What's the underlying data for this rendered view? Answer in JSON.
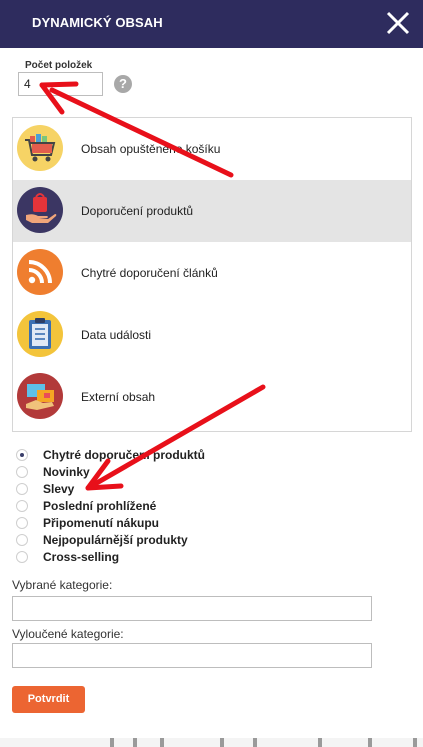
{
  "header": {
    "title": "DYNAMICKÝ OBSAH",
    "close_icon": "close-icon"
  },
  "count": {
    "label": "Počet položek",
    "value": "4",
    "help_icon": "help-icon",
    "help_glyph": "?"
  },
  "content_types": [
    {
      "label": "Obsah opuštěného košíku",
      "icon": "shopping-cart-icon",
      "selected": false
    },
    {
      "label": "Doporučení produktů",
      "icon": "product-recommendation-icon",
      "selected": true
    },
    {
      "label": "Chytré doporučení článků",
      "icon": "rss-icon",
      "selected": false
    },
    {
      "label": "Data události",
      "icon": "clipboard-icon",
      "selected": false
    },
    {
      "label": "Externí obsah",
      "icon": "external-content-icon",
      "selected": false
    }
  ],
  "recommendation_types": {
    "selected": "Chytré doporučení produktů",
    "options": [
      "Chytré doporučení produktů",
      "Novinky",
      "Slevy",
      "Poslední prohlížené",
      "Připomenutí nákupu",
      "Nejpopulárnější produkty",
      "Cross-selling"
    ]
  },
  "included_categories": {
    "label": "Vybrané kategorie:",
    "value": ""
  },
  "excluded_categories": {
    "label": "Vyloučené kategorie:",
    "value": ""
  },
  "confirm": {
    "label": "Potvrdit"
  },
  "colors": {
    "header": "#2e2c5e",
    "accent": "#ec6532",
    "selected_row": "#e4e4e4",
    "annotation_arrow": "#e8101a"
  }
}
